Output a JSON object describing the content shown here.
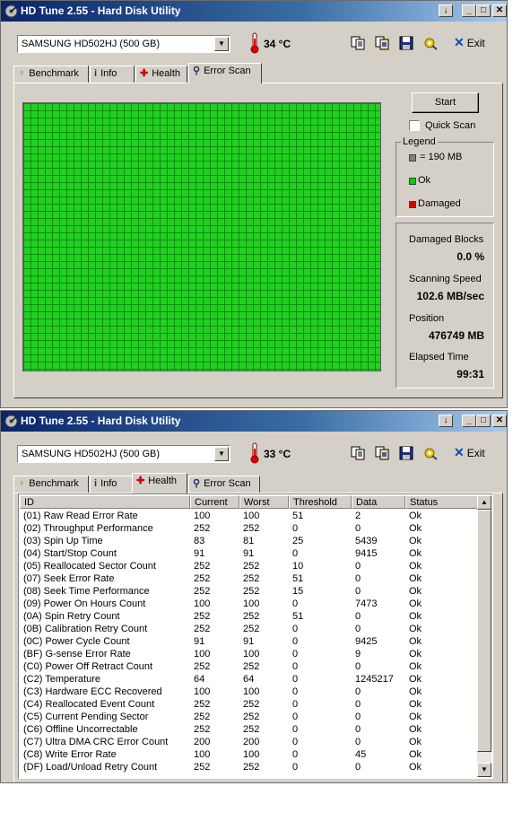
{
  "window1": {
    "title": "HD Tune 2.55 - Hard Disk Utility",
    "title_buttons": [
      "↓",
      "_",
      "□",
      "✕"
    ],
    "drive": "SAMSUNG HD502HJ (500 GB)",
    "temperature": "34 °C",
    "exit_label": "Exit",
    "tabs": [
      {
        "label": "Benchmark",
        "icon": "benchmark-icon"
      },
      {
        "label": "Info",
        "icon": "info-icon"
      },
      {
        "label": "Health",
        "icon": "health-icon"
      },
      {
        "label": "Error Scan",
        "icon": "search-icon",
        "active": true
      }
    ],
    "start_label": "Start",
    "quick_scan_label": "Quick Scan",
    "legend": {
      "title": "Legend",
      "block_size": "= 190 MB",
      "ok": "Ok",
      "damaged": "Damaged",
      "colors": {
        "block": "#808080",
        "ok": "#00c000",
        "damaged": "#c00000"
      }
    },
    "stats": {
      "damaged_blocks_label": "Damaged Blocks",
      "damaged_blocks_value": "0.0 %",
      "scanning_speed_label": "Scanning Speed",
      "scanning_speed_value": "102.6 MB/sec",
      "position_label": "Position",
      "position_value": "476749 MB",
      "elapsed_label": "Elapsed Time",
      "elapsed_value": "99:31"
    }
  },
  "window2": {
    "title": "HD Tune 2.55 - Hard Disk Utility",
    "title_buttons": [
      "↓",
      "_",
      "□",
      "✕"
    ],
    "drive": "SAMSUNG HD502HJ (500 GB)",
    "temperature": "33 °C",
    "exit_label": "Exit",
    "tabs": [
      {
        "label": "Benchmark",
        "icon": "benchmark-icon"
      },
      {
        "label": "Info",
        "icon": "info-icon"
      },
      {
        "label": "Health",
        "icon": "health-icon",
        "active": true
      },
      {
        "label": "Error Scan",
        "icon": "search-icon"
      }
    ],
    "columns": [
      "ID",
      "Current",
      "Worst",
      "Threshold",
      "Data",
      "Status"
    ],
    "rows": [
      [
        "(01) Raw Read Error Rate",
        "100",
        "100",
        "51",
        "2",
        "Ok"
      ],
      [
        "(02) Throughput Performance",
        "252",
        "252",
        "0",
        "0",
        "Ok"
      ],
      [
        "(03) Spin Up Time",
        "83",
        "81",
        "25",
        "5439",
        "Ok"
      ],
      [
        "(04) Start/Stop Count",
        "91",
        "91",
        "0",
        "9415",
        "Ok"
      ],
      [
        "(05) Reallocated Sector Count",
        "252",
        "252",
        "10",
        "0",
        "Ok"
      ],
      [
        "(07) Seek Error Rate",
        "252",
        "252",
        "51",
        "0",
        "Ok"
      ],
      [
        "(08) Seek Time Performance",
        "252",
        "252",
        "15",
        "0",
        "Ok"
      ],
      [
        "(09) Power On Hours Count",
        "100",
        "100",
        "0",
        "7473",
        "Ok"
      ],
      [
        "(0A) Spin Retry Count",
        "252",
        "252",
        "51",
        "0",
        "Ok"
      ],
      [
        "(0B) Calibration Retry Count",
        "252",
        "252",
        "0",
        "0",
        "Ok"
      ],
      [
        "(0C) Power Cycle Count",
        "91",
        "91",
        "0",
        "9425",
        "Ok"
      ],
      [
        "(BF) G-sense Error Rate",
        "100",
        "100",
        "0",
        "9",
        "Ok"
      ],
      [
        "(C0) Power Off Retract Count",
        "252",
        "252",
        "0",
        "0",
        "Ok"
      ],
      [
        "(C2) Temperature",
        "64",
        "64",
        "0",
        "1245217",
        "Ok"
      ],
      [
        "(C3) Hardware ECC Recovered",
        "100",
        "100",
        "0",
        "0",
        "Ok"
      ],
      [
        "(C4) Reallocated Event Count",
        "252",
        "252",
        "0",
        "0",
        "Ok"
      ],
      [
        "(C5) Current Pending Sector",
        "252",
        "252",
        "0",
        "0",
        "Ok"
      ],
      [
        "(C6) Offline Uncorrectable",
        "252",
        "252",
        "0",
        "0",
        "Ok"
      ],
      [
        "(C7) Ultra DMA CRC Error Count",
        "200",
        "200",
        "0",
        "0",
        "Ok"
      ],
      [
        "(C8) Write Error Rate",
        "100",
        "100",
        "0",
        "45",
        "Ok"
      ],
      [
        "(DF) Load/Unload Retry Count",
        "252",
        "252",
        "0",
        "0",
        "Ok"
      ]
    ]
  }
}
